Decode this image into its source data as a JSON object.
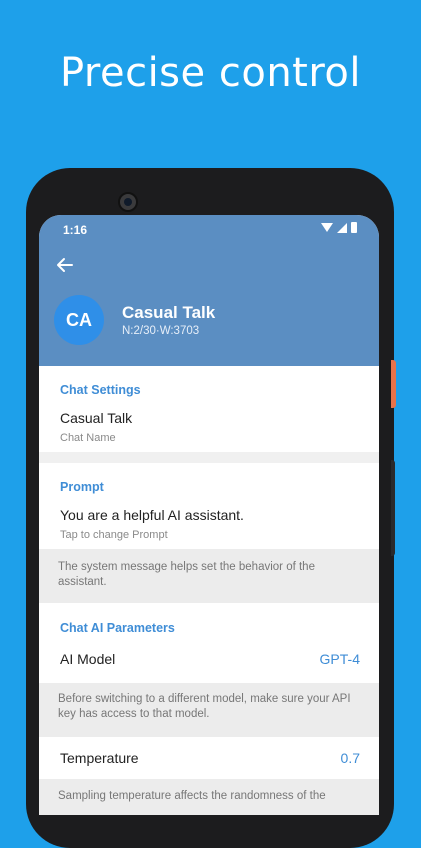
{
  "headline": "Precise control",
  "status_bar": {
    "time": "1:16"
  },
  "header": {
    "avatar_initials": "CA",
    "title": "Casual Talk",
    "subtitle": "N:2/30·W:3703"
  },
  "chat_settings": {
    "section_title": "Chat Settings",
    "chat_name_value": "Casual Talk",
    "chat_name_label": "Chat Name"
  },
  "prompt": {
    "section_title": "Prompt",
    "value": "You are a helpful AI assistant.",
    "hint": "Tap to change Prompt",
    "info": "The system message helps set the behavior of the assistant."
  },
  "ai_params": {
    "section_title": "Chat AI Parameters",
    "model_label": "AI Model",
    "model_value": "GPT-4",
    "model_info": "Before switching to a different model, make sure your API key has access to that model.",
    "temperature_label": "Temperature",
    "temperature_value": "0.7",
    "temperature_info": "Sampling temperature affects the randomness of the"
  },
  "colors": {
    "background": "#1ea0ea",
    "header": "#5b8ec2",
    "accent": "#3f8dd6",
    "avatar": "#2f8fe8",
    "side_button": "#e8734a"
  }
}
